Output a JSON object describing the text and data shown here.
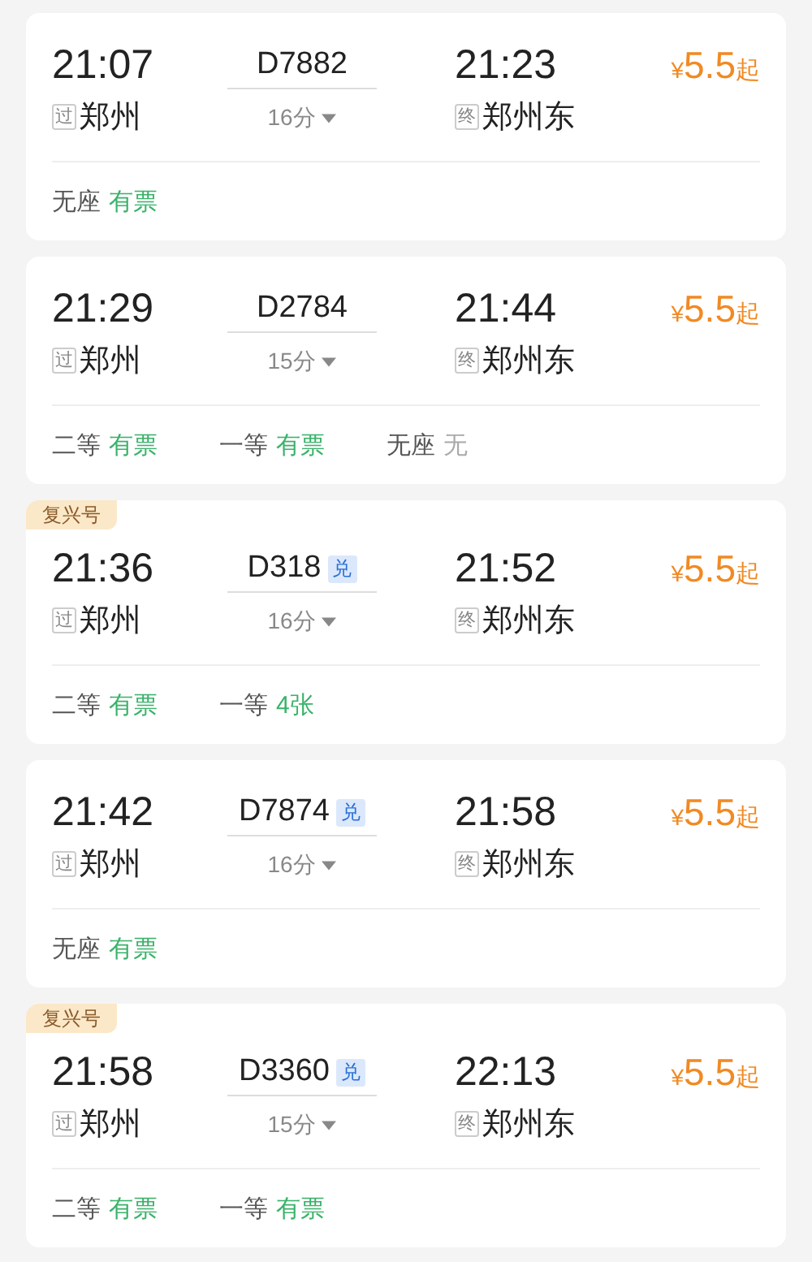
{
  "trains": [
    {
      "depart_time": "21:07",
      "depart_tag": "过",
      "depart_station": "郑州",
      "train_no": "D7882",
      "duration": "16分",
      "arrive_time": "21:23",
      "arrive_tag": "终",
      "arrive_station": "郑州东",
      "currency": "¥",
      "price": "5.5",
      "price_suffix": "起",
      "seats": [
        {
          "class": "无座",
          "status": "有票",
          "available": true
        }
      ]
    },
    {
      "depart_time": "21:29",
      "depart_tag": "过",
      "depart_station": "郑州",
      "train_no": "D2784",
      "duration": "15分",
      "arrive_time": "21:44",
      "arrive_tag": "终",
      "arrive_station": "郑州东",
      "currency": "¥",
      "price": "5.5",
      "price_suffix": "起",
      "seats": [
        {
          "class": "二等",
          "status": "有票",
          "available": true
        },
        {
          "class": "一等",
          "status": "有票",
          "available": true
        },
        {
          "class": "无座",
          "status": "无",
          "available": false
        }
      ]
    },
    {
      "badge": "复兴号",
      "depart_time": "21:36",
      "depart_tag": "过",
      "depart_station": "郑州",
      "train_no": "D318",
      "redeem": "兑",
      "duration": "16分",
      "arrive_time": "21:52",
      "arrive_tag": "终",
      "arrive_station": "郑州东",
      "currency": "¥",
      "price": "5.5",
      "price_suffix": "起",
      "seats": [
        {
          "class": "二等",
          "status": "有票",
          "available": true
        },
        {
          "class": "一等",
          "status": "4张",
          "available": true
        }
      ]
    },
    {
      "depart_time": "21:42",
      "depart_tag": "过",
      "depart_station": "郑州",
      "train_no": "D7874",
      "redeem": "兑",
      "duration": "16分",
      "arrive_time": "21:58",
      "arrive_tag": "终",
      "arrive_station": "郑州东",
      "currency": "¥",
      "price": "5.5",
      "price_suffix": "起",
      "seats": [
        {
          "class": "无座",
          "status": "有票",
          "available": true
        }
      ]
    },
    {
      "badge": "复兴号",
      "depart_time": "21:58",
      "depart_tag": "过",
      "depart_station": "郑州",
      "train_no": "D3360",
      "redeem": "兑",
      "duration": "15分",
      "arrive_time": "22:13",
      "arrive_tag": "终",
      "arrive_station": "郑州东",
      "currency": "¥",
      "price": "5.5",
      "price_suffix": "起",
      "seats": [
        {
          "class": "二等",
          "status": "有票",
          "available": true
        },
        {
          "class": "一等",
          "status": "有票",
          "available": true
        }
      ]
    }
  ]
}
